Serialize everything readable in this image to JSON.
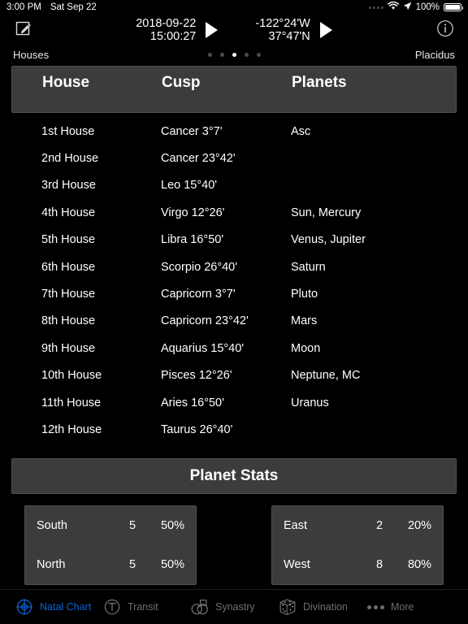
{
  "status_bar": {
    "time": "3:00 PM",
    "date": "Sat Sep 22",
    "battery_percent": "100%",
    "icons": [
      "signal-dots-icon",
      "wifi-icon",
      "location-arrow-icon",
      "battery-icon"
    ]
  },
  "toolbar": {
    "compose_icon": "compose-icon",
    "date": "2018-09-22",
    "time": "15:00:27",
    "longitude": "-122°24'W",
    "latitude": "37°47'N",
    "play_date_icon": "play-icon",
    "play_coords_icon": "play-icon",
    "info_icon": "info-icon"
  },
  "subheader": {
    "left_label": "Houses",
    "right_label": "Placidus",
    "page_count": 5,
    "active_page": 3
  },
  "table": {
    "columns": [
      "House",
      "Cusp",
      "Planets"
    ],
    "rows": [
      {
        "house": "1st House",
        "cusp": "Cancer 3°7'",
        "planets": "Asc"
      },
      {
        "house": "2nd House",
        "cusp": "Cancer 23°42'",
        "planets": ""
      },
      {
        "house": "3rd House",
        "cusp": "Leo 15°40'",
        "planets": ""
      },
      {
        "house": "4th House",
        "cusp": "Virgo 12°26'",
        "planets": "Sun, Mercury"
      },
      {
        "house": "5th House",
        "cusp": "Libra 16°50'",
        "planets": "Venus, Jupiter"
      },
      {
        "house": "6th House",
        "cusp": "Scorpio 26°40'",
        "planets": "Saturn"
      },
      {
        "house": "7th House",
        "cusp": "Capricorn 3°7'",
        "planets": "Pluto"
      },
      {
        "house": "8th House",
        "cusp": "Capricorn 23°42'",
        "planets": "Mars"
      },
      {
        "house": "9th House",
        "cusp": "Aquarius 15°40'",
        "planets": "Moon"
      },
      {
        "house": "10th House",
        "cusp": "Pisces 12°26'",
        "planets": "Neptune, MC"
      },
      {
        "house": "11th House",
        "cusp": "Aries 16°50'",
        "planets": "Uranus"
      },
      {
        "house": "12th House",
        "cusp": "Taurus 26°40'",
        "planets": ""
      }
    ]
  },
  "planet_stats": {
    "title": "Planet Stats",
    "left_box": [
      {
        "label": "South",
        "count": "5",
        "percent": "50%"
      },
      {
        "label": "North",
        "count": "5",
        "percent": "50%"
      }
    ],
    "right_box": [
      {
        "label": "East",
        "count": "2",
        "percent": "20%"
      },
      {
        "label": "West",
        "count": "8",
        "percent": "80%"
      }
    ]
  },
  "tabbar": {
    "active_color": "#0a63d6",
    "inactive_color": "#6e6e6e",
    "tabs": [
      {
        "label": "Natal Chart",
        "icon": "natal-chart-icon",
        "active": true
      },
      {
        "label": "Transit",
        "icon": "transit-icon",
        "active": false
      },
      {
        "label": "Synastry",
        "icon": "synastry-icon",
        "active": false
      },
      {
        "label": "Divination",
        "icon": "divination-dice-icon",
        "active": false
      },
      {
        "label": "More",
        "icon": "ellipsis-icon",
        "active": false
      }
    ]
  }
}
